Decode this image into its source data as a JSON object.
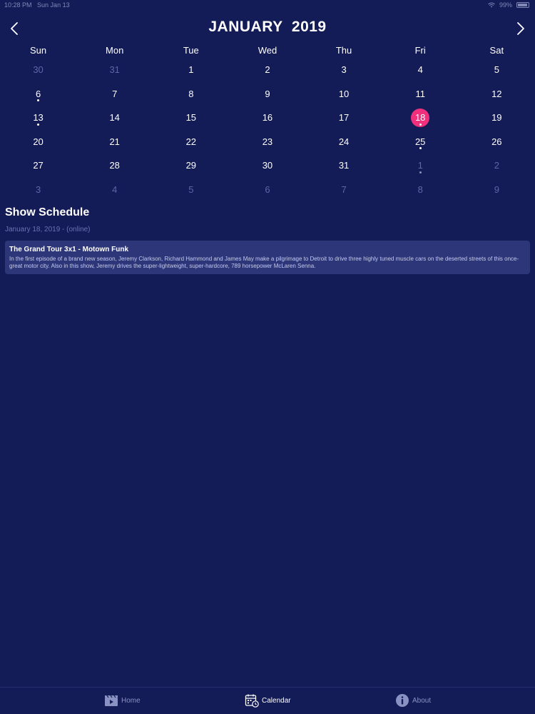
{
  "status_bar": {
    "time": "10:28 PM",
    "date": "Sun Jan 13",
    "battery": "99%"
  },
  "calendar": {
    "month_title": "JANUARY  2019",
    "weekdays": [
      "Sun",
      "Mon",
      "Tue",
      "Wed",
      "Thu",
      "Fri",
      "Sat"
    ],
    "days": [
      {
        "label": "30",
        "other": true,
        "dot": false,
        "selected": false
      },
      {
        "label": "31",
        "other": true,
        "dot": false,
        "selected": false
      },
      {
        "label": "1",
        "other": false,
        "dot": false,
        "selected": false
      },
      {
        "label": "2",
        "other": false,
        "dot": false,
        "selected": false
      },
      {
        "label": "3",
        "other": false,
        "dot": false,
        "selected": false
      },
      {
        "label": "4",
        "other": false,
        "dot": false,
        "selected": false
      },
      {
        "label": "5",
        "other": false,
        "dot": false,
        "selected": false
      },
      {
        "label": "6",
        "other": false,
        "dot": true,
        "selected": false
      },
      {
        "label": "7",
        "other": false,
        "dot": false,
        "selected": false
      },
      {
        "label": "8",
        "other": false,
        "dot": false,
        "selected": false
      },
      {
        "label": "9",
        "other": false,
        "dot": false,
        "selected": false
      },
      {
        "label": "10",
        "other": false,
        "dot": false,
        "selected": false
      },
      {
        "label": "11",
        "other": false,
        "dot": false,
        "selected": false
      },
      {
        "label": "12",
        "other": false,
        "dot": false,
        "selected": false
      },
      {
        "label": "13",
        "other": false,
        "dot": true,
        "selected": false
      },
      {
        "label": "14",
        "other": false,
        "dot": false,
        "selected": false
      },
      {
        "label": "15",
        "other": false,
        "dot": false,
        "selected": false
      },
      {
        "label": "16",
        "other": false,
        "dot": false,
        "selected": false
      },
      {
        "label": "17",
        "other": false,
        "dot": false,
        "selected": false
      },
      {
        "label": "18",
        "other": false,
        "dot": true,
        "selected": true
      },
      {
        "label": "19",
        "other": false,
        "dot": false,
        "selected": false
      },
      {
        "label": "20",
        "other": false,
        "dot": false,
        "selected": false
      },
      {
        "label": "21",
        "other": false,
        "dot": false,
        "selected": false
      },
      {
        "label": "22",
        "other": false,
        "dot": false,
        "selected": false
      },
      {
        "label": "23",
        "other": false,
        "dot": false,
        "selected": false
      },
      {
        "label": "24",
        "other": false,
        "dot": false,
        "selected": false
      },
      {
        "label": "25",
        "other": false,
        "dot": true,
        "selected": false
      },
      {
        "label": "26",
        "other": false,
        "dot": false,
        "selected": false
      },
      {
        "label": "27",
        "other": false,
        "dot": false,
        "selected": false
      },
      {
        "label": "28",
        "other": false,
        "dot": false,
        "selected": false
      },
      {
        "label": "29",
        "other": false,
        "dot": false,
        "selected": false
      },
      {
        "label": "30",
        "other": false,
        "dot": false,
        "selected": false
      },
      {
        "label": "31",
        "other": false,
        "dot": false,
        "selected": false
      },
      {
        "label": "1",
        "other": true,
        "dot": true,
        "selected": false
      },
      {
        "label": "2",
        "other": true,
        "dot": false,
        "selected": false
      },
      {
        "label": "3",
        "other": true,
        "dot": false,
        "selected": false
      },
      {
        "label": "4",
        "other": true,
        "dot": false,
        "selected": false
      },
      {
        "label": "5",
        "other": true,
        "dot": false,
        "selected": false
      },
      {
        "label": "6",
        "other": true,
        "dot": false,
        "selected": false
      },
      {
        "label": "7",
        "other": true,
        "dot": false,
        "selected": false
      },
      {
        "label": "8",
        "other": true,
        "dot": false,
        "selected": false
      },
      {
        "label": "9",
        "other": true,
        "dot": false,
        "selected": false
      }
    ]
  },
  "schedule": {
    "title": "Show Schedule",
    "subtitle": "January 18, 2019 - (online)",
    "shows": [
      {
        "title": "The Grand Tour 3x1 - Motown Funk",
        "description": "In the first episode of a brand new season, Jeremy Clarkson, Richard Hammond and James May make a pilgrimage to Detroit to drive three highly tuned muscle cars on the deserted streets of this once-great motor city. Also in this show, Jeremy drives the super-lightweight, super-hardcore, 789 horsepower McLaren Senna."
      }
    ]
  },
  "tabs": {
    "home": "Home",
    "calendar": "Calendar",
    "about": "About"
  },
  "colors": {
    "background": "#131c56",
    "selected_day": "#f0307d",
    "card": "#2c3679"
  }
}
